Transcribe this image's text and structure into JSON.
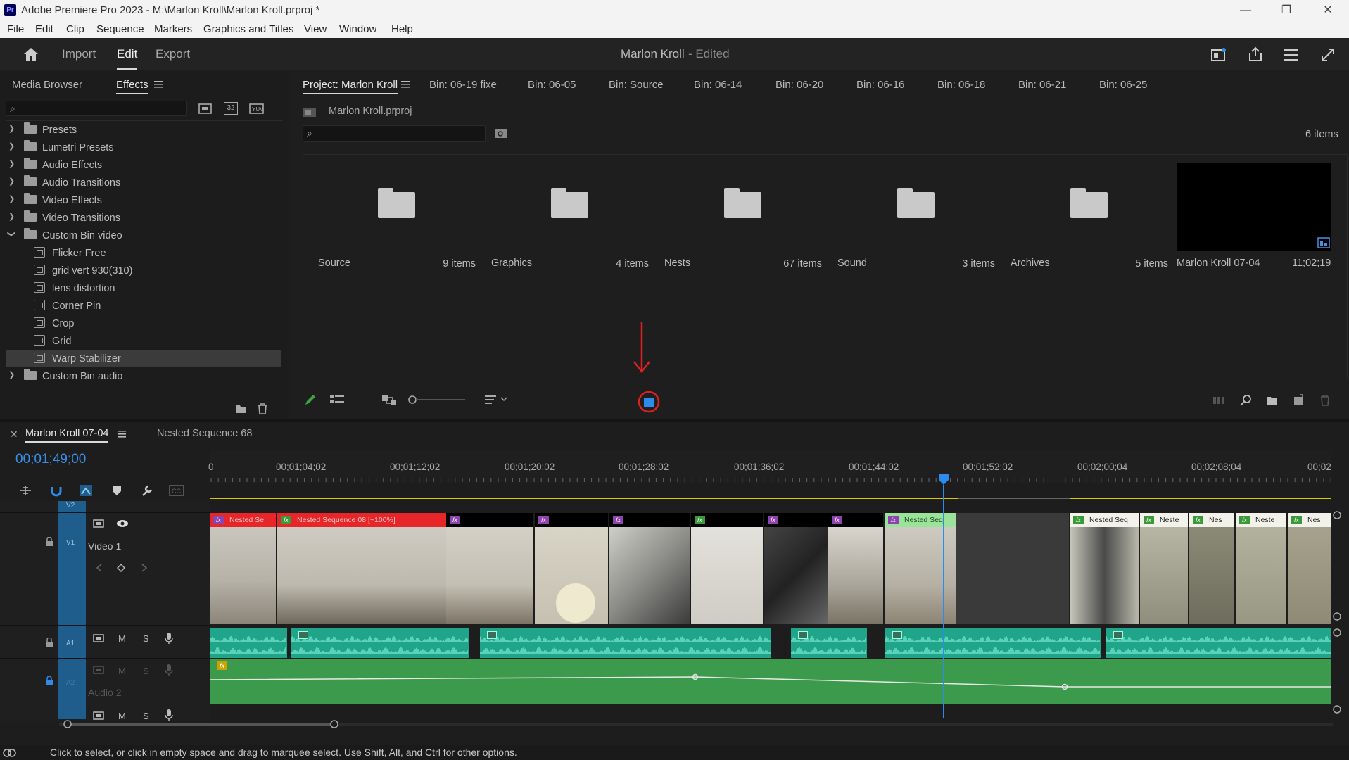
{
  "window": {
    "title": "Adobe Premiere Pro 2023 - M:\\Marlon Kroll\\Marlon Kroll.prproj *",
    "app_badge": "Pr",
    "minimize": "—",
    "restore": "❐",
    "close": "✕"
  },
  "menu": [
    "File",
    "Edit",
    "Clip",
    "Sequence",
    "Markers",
    "Graphics and Titles",
    "View",
    "Window",
    "Help"
  ],
  "header": {
    "tabs": [
      "Import",
      "Edit",
      "Export"
    ],
    "active_tab": "Edit",
    "project_name": "Marlon Kroll",
    "status": "- Edited"
  },
  "effects_panel": {
    "tabs": [
      "Media Browser",
      "Effects"
    ],
    "active_tab": "Effects",
    "search_placeholder": "",
    "buttons": [
      "32"
    ],
    "tree": [
      {
        "label": "Presets",
        "type": "preset-folder",
        "expanded": false,
        "depth": 0
      },
      {
        "label": "Lumetri Presets",
        "type": "preset-folder",
        "expanded": false,
        "depth": 0
      },
      {
        "label": "Audio Effects",
        "type": "folder",
        "expanded": false,
        "depth": 0
      },
      {
        "label": "Audio Transitions",
        "type": "folder",
        "expanded": false,
        "depth": 0
      },
      {
        "label": "Video Effects",
        "type": "folder",
        "expanded": false,
        "depth": 0
      },
      {
        "label": "Video Transitions",
        "type": "folder",
        "expanded": false,
        "depth": 0
      },
      {
        "label": "Custom Bin video",
        "type": "folder",
        "expanded": true,
        "depth": 0
      },
      {
        "label": "Flicker Free",
        "type": "effect",
        "depth": 1
      },
      {
        "label": "grid vert 930(310)",
        "type": "effect",
        "depth": 1
      },
      {
        "label": "lens distortion",
        "type": "effect",
        "depth": 1
      },
      {
        "label": "Corner Pin",
        "type": "effect",
        "depth": 1
      },
      {
        "label": "Crop",
        "type": "effect",
        "depth": 1
      },
      {
        "label": "Grid",
        "type": "effect",
        "depth": 1
      },
      {
        "label": "Warp Stabilizer",
        "type": "effect",
        "depth": 1,
        "selected": true
      },
      {
        "label": "Custom Bin audio",
        "type": "folder",
        "expanded": false,
        "depth": 0
      }
    ]
  },
  "project_panel": {
    "tabs": [
      "Project: Marlon Kroll",
      "Bin: 06-19 fixe",
      "Bin: 06-05",
      "Bin: Source",
      "Bin: 06-14",
      "Bin: 06-20",
      "Bin: 06-16",
      "Bin: 06-18",
      "Bin: 06-21",
      "Bin: 06-25"
    ],
    "path": "Marlon Kroll.prproj",
    "item_count": "6 items",
    "bins": [
      {
        "name": "Source",
        "count": "9 items"
      },
      {
        "name": "Graphics",
        "count": "4 items"
      },
      {
        "name": "Nests",
        "count": "67 items"
      },
      {
        "name": "Sound",
        "count": "3 items"
      },
      {
        "name": "Archives",
        "count": "5 items"
      }
    ],
    "sequence": {
      "name": "Marlon Kroll 07-04",
      "duration": "11;02;19"
    },
    "annotation": "red arrow and circle highlighting the icon view button"
  },
  "timeline": {
    "tabs": [
      "Marlon Kroll 07-04",
      "Nested Sequence 68"
    ],
    "timecode": "00;01;49;00",
    "ruler_labels": [
      "0",
      "00;01;04;02",
      "00;01;12;02",
      "00;01;20;02",
      "00;01;28;02",
      "00;01;36;02",
      "00;01;44;02",
      "00;01;52;02",
      "00;02;00;04",
      "00;02;08;04",
      "00;02"
    ],
    "tracks": {
      "v2": "V2",
      "v1": "V1",
      "v1_name": "Video 1",
      "a1": "A1",
      "a2": "A2",
      "a2_name": "Audio 2",
      "mute": "M",
      "solo": "S"
    },
    "video_clips": [
      {
        "label": "Nested Se",
        "color": "red"
      },
      {
        "label": "Nested Sequence 08 [~100%]",
        "color": "red"
      },
      {
        "label": "",
        "color": "purple"
      },
      {
        "label": "",
        "color": "purple"
      },
      {
        "label": "",
        "color": "purple"
      },
      {
        "label": "",
        "color": "green"
      },
      {
        "label": "",
        "color": "purple"
      },
      {
        "label": "",
        "color": "purple"
      },
      {
        "label": "Nested Seq",
        "color": "lightgreen"
      },
      {
        "label": "Nested Seq",
        "color": "white"
      },
      {
        "label": "Neste",
        "color": "white"
      },
      {
        "label": "Nes",
        "color": "white"
      },
      {
        "label": "Neste",
        "color": "white"
      },
      {
        "label": "Nes",
        "color": "white"
      }
    ],
    "fx_badge": "fx"
  },
  "status_bar": {
    "message": "Click to select, or click in empty space and drag to marquee select. Use Shift, Alt, and Ctrl for other options."
  },
  "colors": {
    "accent_blue": "#2d8ceb",
    "track_blue": "#1f5d8c",
    "audio_clip": "#21a58a",
    "audio2_green": "#3b9a4b",
    "annotation_red": "#e02020"
  }
}
